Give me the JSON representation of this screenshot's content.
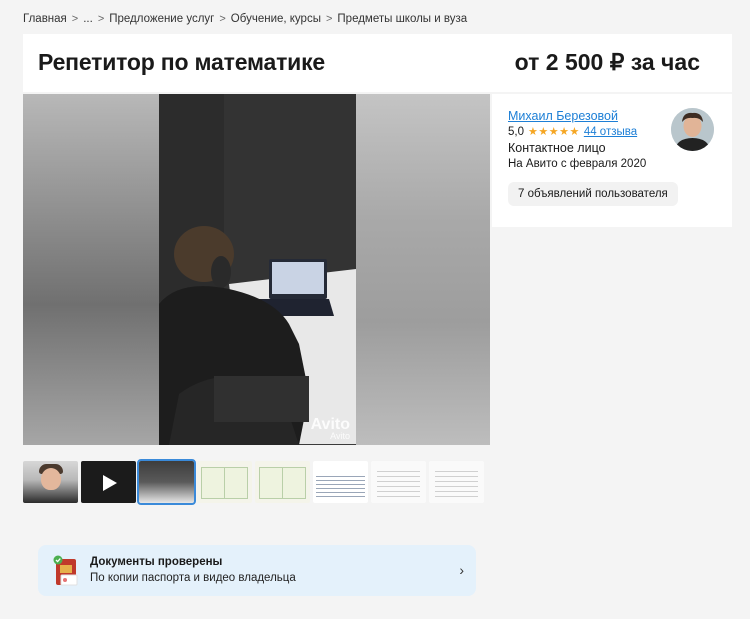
{
  "breadcrumb": {
    "items": [
      "Главная",
      "...",
      "Предложение услуг",
      "Обучение, курсы",
      "Предметы школы и вуза"
    ],
    "separator": ">"
  },
  "listing": {
    "title": "Репетитор по математике",
    "price": "от 2 500 ₽ за час"
  },
  "gallery": {
    "watermark": "Avito",
    "watermark_small": "Avito",
    "thumbnails": [
      "photo",
      "video",
      "photo-selected",
      "certificate",
      "certificate",
      "table",
      "document",
      "document"
    ]
  },
  "seller": {
    "name": "Михаил Березовой",
    "rating": "5,0",
    "stars": "★★★★★",
    "reviews": "44 отзыва",
    "role": "Контактное лицо",
    "since": "На Авито с февраля 2020",
    "ads_button": "7 объявлений пользователя"
  },
  "verification": {
    "title": "Документы проверены",
    "subtitle": "По копии паспорта и видео владельца",
    "chevron": "›"
  },
  "colors": {
    "link": "#1d7fd6",
    "star": "#f5a623",
    "verified_bg": "#e4f1fb",
    "active_thumb": "#3a8ad9"
  }
}
